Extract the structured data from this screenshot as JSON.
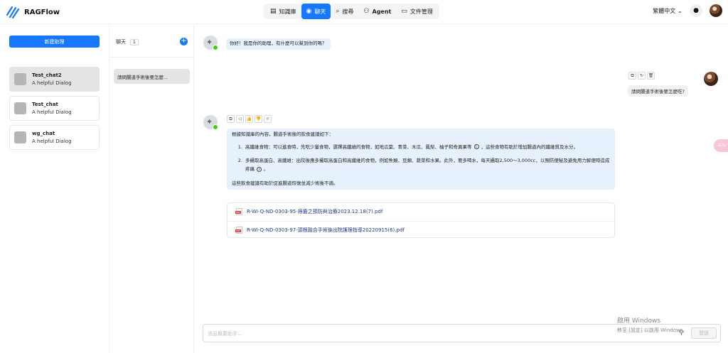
{
  "app": {
    "name": "RAGFlow"
  },
  "nav": [
    {
      "label": "知識庫",
      "icon": "database-icon"
    },
    {
      "label": "聊天",
      "icon": "chat-icon",
      "active": true
    },
    {
      "label": "搜尋",
      "icon": "search-icon"
    },
    {
      "label": "Agent",
      "icon": "agent-icon"
    },
    {
      "label": "文件管理",
      "icon": "folder-icon"
    }
  ],
  "header": {
    "language": "繁體中文"
  },
  "left": {
    "new_button": "新建助理",
    "assistants": [
      {
        "name": "Test_chat2",
        "desc": "A helpful Dialog",
        "selected": true
      },
      {
        "name": "Test_chat",
        "desc": "A helpful Dialog"
      },
      {
        "name": "wg_chat",
        "desc": "A helpful Dialog"
      }
    ]
  },
  "mid": {
    "title": "聊天",
    "count": "1",
    "conversations": [
      "請問腸道手術後要怎麼..."
    ]
  },
  "chat": {
    "greeting": "你好！我是你的助理，有什麼可以幫到你的嗎？",
    "user_message": "請問腸道手術後要怎麼吃?",
    "answer": {
      "intro": "根據知識庫的內容，腸道手術後的飲食建議如下：",
      "item1": "高纖維食物：可以進食時，先吃少量食物，選擇高纖維的食物，如地瓜葉、青菜、木瓜、鳳梨、柚子和奇異果等",
      "item1_tail": "，這些食物有助於增加腸道內的纖維質及水分。",
      "item2": "多攝取高蛋白、高纖維：出院後應多攝取高蛋白和高纖維的食物，例如魚類、豆類、蔬菜和水果。此外，要多喝水，每天攝取2,500～3,000cc，以預防便秘及避免用力解便時造成疼痛",
      "item2_tail": "。",
      "outro": "這些飲食建議有助於促進腸道恢復並減少術後不適。"
    },
    "references": [
      "R-WI-Q-ND-0303-95-痔瘡之預防與治療2023.12.18(7).pdf",
      "R-WI-Q-ND-0303-97-頭根融合手術後出院護理指導20220915(6).pdf"
    ],
    "input_placeholder": "消息概要助手...",
    "send_label": "發送"
  },
  "watermark": {
    "line1": "啟用 Windows",
    "line2": "移至 [設定] 以啟用 Windows。"
  },
  "side_tab": "ぷん"
}
